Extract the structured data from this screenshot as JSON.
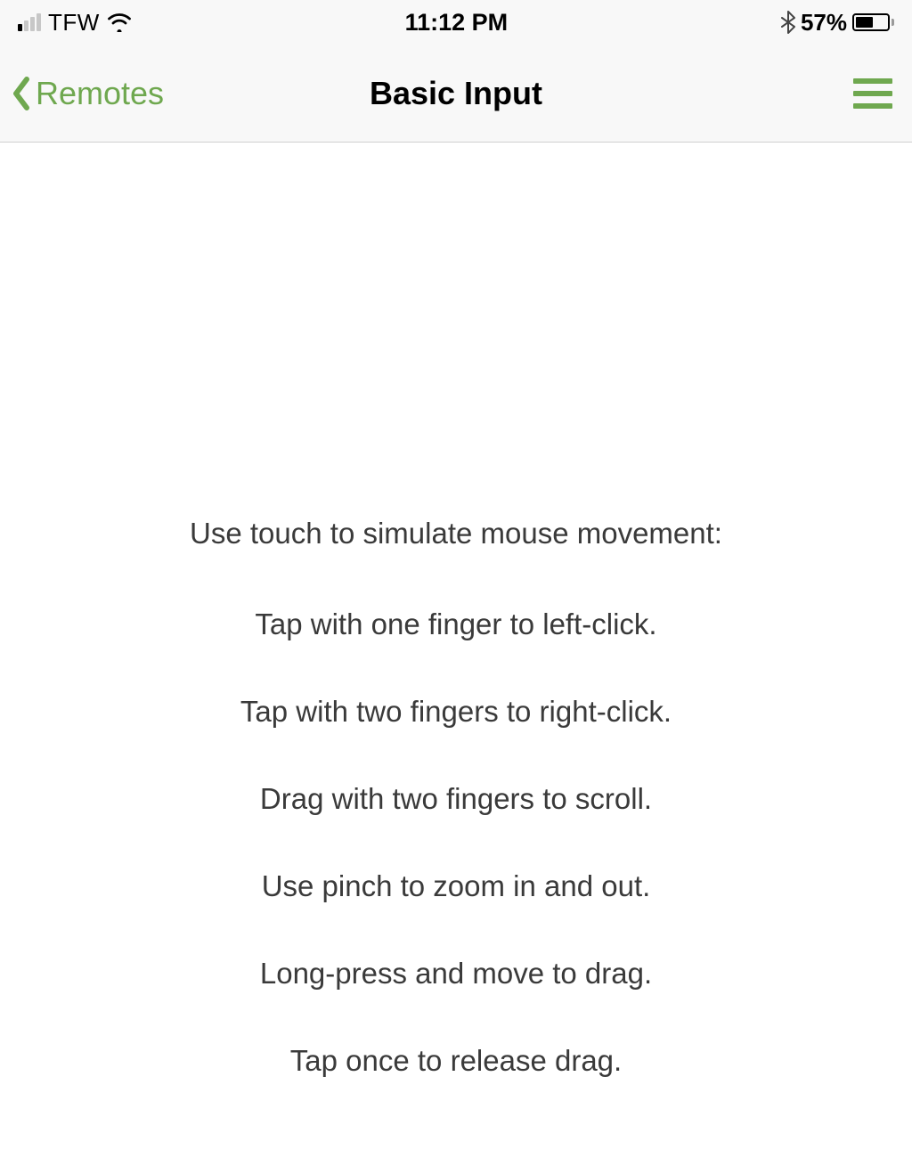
{
  "status_bar": {
    "carrier": "TFW",
    "time": "11:12 PM",
    "battery_percent": "57%"
  },
  "nav": {
    "back_label": "Remotes",
    "title": "Basic Input"
  },
  "instructions": {
    "header": "Use touch to simulate mouse movement:",
    "lines": [
      "Tap with one finger to left-click.",
      "Tap with two fingers to right-click.",
      "Drag with two fingers to scroll.",
      "Use pinch to zoom in and out.",
      "Long-press and move to drag.",
      "Tap once to release drag."
    ]
  },
  "colors": {
    "accent": "#6fa84f"
  }
}
